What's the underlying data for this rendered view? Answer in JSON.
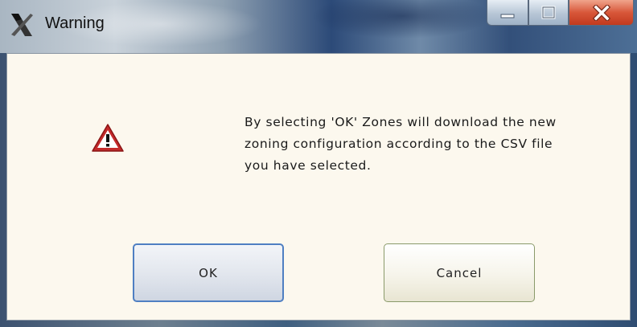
{
  "window": {
    "title": "Warning",
    "controls": {
      "minimize": "minimize",
      "maximize": "maximize",
      "close": "close"
    }
  },
  "dialog": {
    "icon": "warning-triangle-icon",
    "message_lines": [
      "By selecting 'OK' Zones will download the new",
      "zoning configuration according to the CSV file",
      "you have selected."
    ],
    "buttons": {
      "ok": "OK",
      "cancel": "Cancel"
    }
  },
  "colors": {
    "warning": "#c42a2a",
    "close_button": "#d8573a",
    "dialog_bg": "#fcf8ee"
  }
}
